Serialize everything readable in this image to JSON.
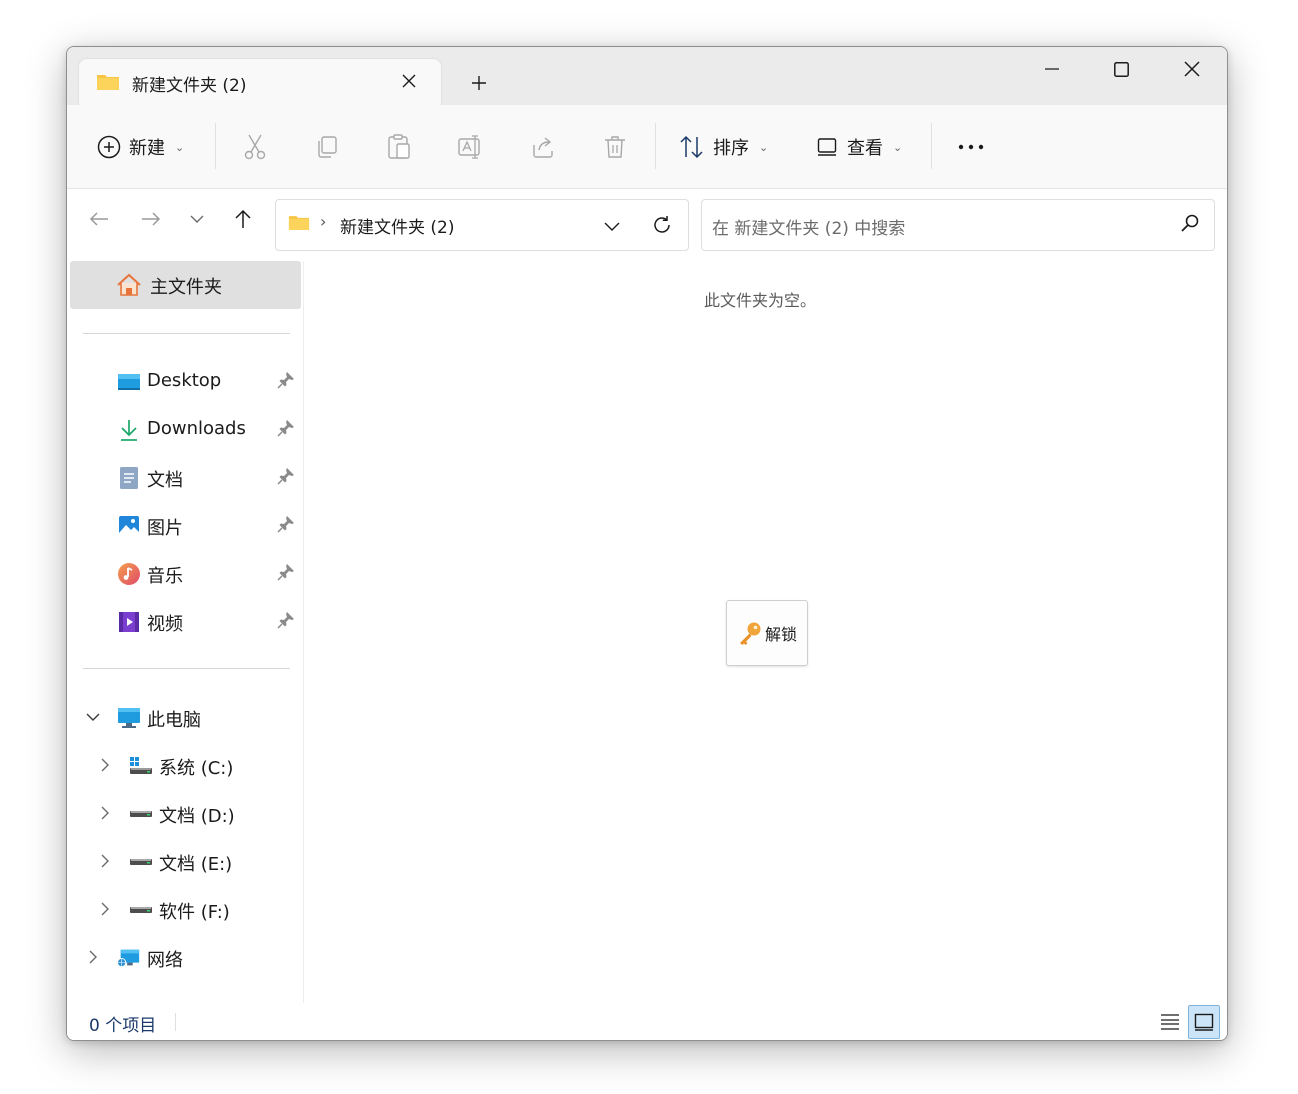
{
  "tab": {
    "title": "新建文件夹 (2)"
  },
  "toolbar": {
    "new_label": "新建",
    "sort_label": "排序",
    "view_label": "查看",
    "more_label": "···",
    "actions": [
      "cut-icon",
      "copy-icon",
      "paste-icon",
      "rename-icon",
      "share-icon",
      "delete-icon"
    ]
  },
  "address": {
    "separator": "›",
    "path": "新建文件夹 (2)"
  },
  "search": {
    "placeholder": "在 新建文件夹 (2) 中搜索"
  },
  "sidebar": {
    "home": "主文件夹",
    "quick_access": [
      {
        "label": "Desktop",
        "icon": "desktop-icon"
      },
      {
        "label": "Downloads",
        "icon": "downloads-icon"
      },
      {
        "label": "文档",
        "icon": "documents-icon"
      },
      {
        "label": "图片",
        "icon": "pictures-icon"
      },
      {
        "label": "音乐",
        "icon": "music-icon"
      },
      {
        "label": "视频",
        "icon": "videos-icon"
      }
    ],
    "this_pc": "此电脑",
    "drives": [
      {
        "label": "系统 (C:)",
        "icon": "system-drive-icon"
      },
      {
        "label": "文档 (D:)",
        "icon": "drive-icon"
      },
      {
        "label": "文档 (E:)",
        "icon": "drive-icon"
      },
      {
        "label": "软件 (F:)",
        "icon": "drive-icon"
      }
    ],
    "network": "网络"
  },
  "content": {
    "empty_message": "此文件夹为空。",
    "unlock_label": "解锁"
  },
  "status": {
    "item_count": "0 个项目"
  },
  "colors": {
    "accent": "#0067c0",
    "folder": "#f8c544",
    "selected": "#e0e0e0"
  }
}
